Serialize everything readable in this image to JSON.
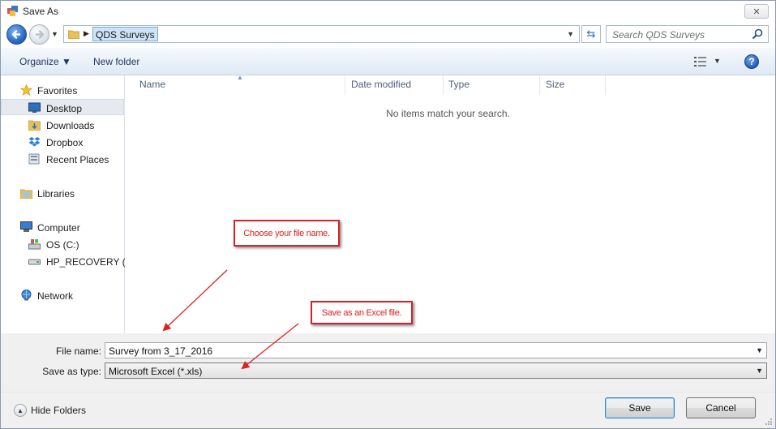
{
  "window": {
    "title": "Save As",
    "close_glyph": "✕"
  },
  "address": {
    "current_folder": "QDS Surveys",
    "crumb_glyph": "▶",
    "dropdown_glyph": "▼",
    "refresh_glyph": "⇆"
  },
  "search": {
    "placeholder": "Search QDS Surveys"
  },
  "toolbar": {
    "organize_label": "Organize ▼",
    "new_folder_label": "New folder",
    "views_dropdown_glyph": "▼",
    "help_glyph": "?"
  },
  "navpane": {
    "favorites": "Favorites",
    "desktop": "Desktop",
    "downloads": "Downloads",
    "dropbox": "Dropbox",
    "recent_places": "Recent Places",
    "libraries": "Libraries",
    "computer": "Computer",
    "os_drive": "OS (C:)",
    "recovery_drive": "HP_RECOVERY (D:",
    "network": "Network",
    "selected": "Desktop"
  },
  "filelist": {
    "columns": {
      "name": "Name",
      "date_modified": "Date modified",
      "type": "Type",
      "size": "Size"
    },
    "sort_glyph": "▲",
    "empty_message": "No items match your search."
  },
  "annotations": {
    "file_name_note": "Choose your file name.",
    "type_note": "Save as an Excel file."
  },
  "form": {
    "file_name_label": "File name:",
    "file_name_value": "Survey from 3_17_2016",
    "save_type_label": "Save as type:",
    "save_type_value": "Microsoft Excel (*.xls)",
    "dropdown_glyph": "▼"
  },
  "footer": {
    "hide_folders_label": "Hide Folders",
    "hide_glyph": "▲",
    "save_label": "Save",
    "cancel_label": "Cancel"
  },
  "colors": {
    "annotation_red": "#d2232a",
    "selection_blue": "#cde3f7",
    "toolbar_gradient_bottom": "#dfe9f5"
  }
}
